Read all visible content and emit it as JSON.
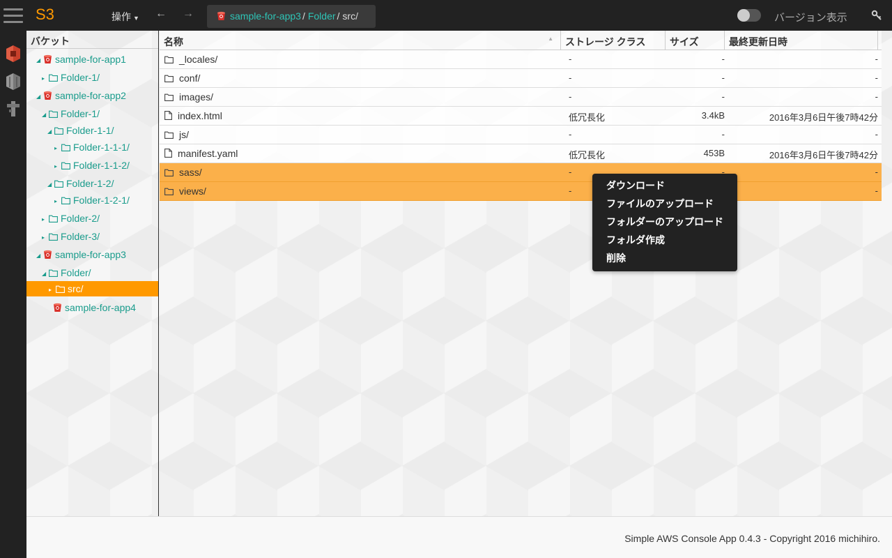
{
  "app": {
    "brand": "S3"
  },
  "header": {
    "ops_label": "操作",
    "breadcrumb": [
      {
        "label": "sample-for-app3",
        "sep": "/"
      },
      {
        "label": "Folder",
        "sep": "/"
      },
      {
        "label": "src/"
      }
    ],
    "version_toggle_label": "バージョン表示",
    "version_toggle_on": false
  },
  "sidebar": {
    "title": "バケット",
    "items": [
      {
        "label": "sample-for-app1",
        "type": "bucket",
        "arrow": "◢"
      },
      {
        "label": "Folder-1/",
        "type": "folder",
        "arrow": "▸"
      },
      {
        "label": "sample-for-app2",
        "type": "bucket",
        "arrow": "◢"
      },
      {
        "label": "Folder-1/",
        "type": "folder",
        "arrow": "◢"
      },
      {
        "label": "Folder-1-1/",
        "type": "folder",
        "arrow": "◢"
      },
      {
        "label": "Folder-1-1-1/",
        "type": "folder",
        "arrow": "▸"
      },
      {
        "label": "Folder-1-1-2/",
        "type": "folder",
        "arrow": "▸"
      },
      {
        "label": "Folder-1-2/",
        "type": "folder",
        "arrow": "◢"
      },
      {
        "label": "Folder-1-2-1/",
        "type": "folder",
        "arrow": "▸"
      },
      {
        "label": "Folder-2/",
        "type": "folder",
        "arrow": "▸"
      },
      {
        "label": "Folder-3/",
        "type": "folder",
        "arrow": "▸"
      },
      {
        "label": "sample-for-app3",
        "type": "bucket",
        "arrow": "◢"
      },
      {
        "label": "Folder/",
        "type": "folder",
        "arrow": "◢"
      },
      {
        "label": "src/",
        "type": "folder",
        "arrow": "▸",
        "selected": true
      },
      {
        "label": "sample-for-app4",
        "type": "bucket",
        "arrow": ""
      }
    ]
  },
  "table": {
    "columns": {
      "name": "名称",
      "storage_class": "ストレージ クラス",
      "size": "サイズ",
      "modified": "最終更新日時"
    },
    "rows": [
      {
        "name": "_locales/",
        "type": "folder",
        "cls": "-",
        "size": "-",
        "date": "-"
      },
      {
        "name": "conf/",
        "type": "folder",
        "cls": "-",
        "size": "-",
        "date": "-"
      },
      {
        "name": "images/",
        "type": "folder",
        "cls": "-",
        "size": "-",
        "date": "-"
      },
      {
        "name": "index.html",
        "type": "file",
        "cls": "低冗長化",
        "size": "3.4kB",
        "date": "2016年3月6日午後7時42分"
      },
      {
        "name": "js/",
        "type": "folder",
        "cls": "-",
        "size": "-",
        "date": "-"
      },
      {
        "name": "manifest.yaml",
        "type": "file",
        "cls": "低冗長化",
        "size": "453B",
        "date": "2016年3月6日午後7時42分"
      },
      {
        "name": "sass/",
        "type": "folder",
        "cls": "-",
        "size": "-",
        "date": "-",
        "selected": true
      },
      {
        "name": "views/",
        "type": "folder",
        "cls": "-",
        "size": "-",
        "date": "-",
        "selected": true
      }
    ]
  },
  "context_menu": {
    "items": [
      "ダウンロード",
      "ファイルのアップロード",
      "フォルダーのアップロード",
      "フォルダ作成",
      "削除"
    ]
  },
  "footer": {
    "text": "Simple AWS Console App 0.4.3 - Copyright 2016 michihiro."
  },
  "colors": {
    "accent": "#ff9900",
    "link": "#1a9c8c",
    "selected_row": "#fbb04a",
    "header_bg": "#222222"
  },
  "icons": {
    "menu": "hamburger-icon",
    "s3": "s3-icon",
    "ec2": "ec2-icon",
    "iam": "iam-icon",
    "bucket": "bucket-icon",
    "folder": "folder-icon",
    "file": "file-icon",
    "key": "key-icon"
  }
}
